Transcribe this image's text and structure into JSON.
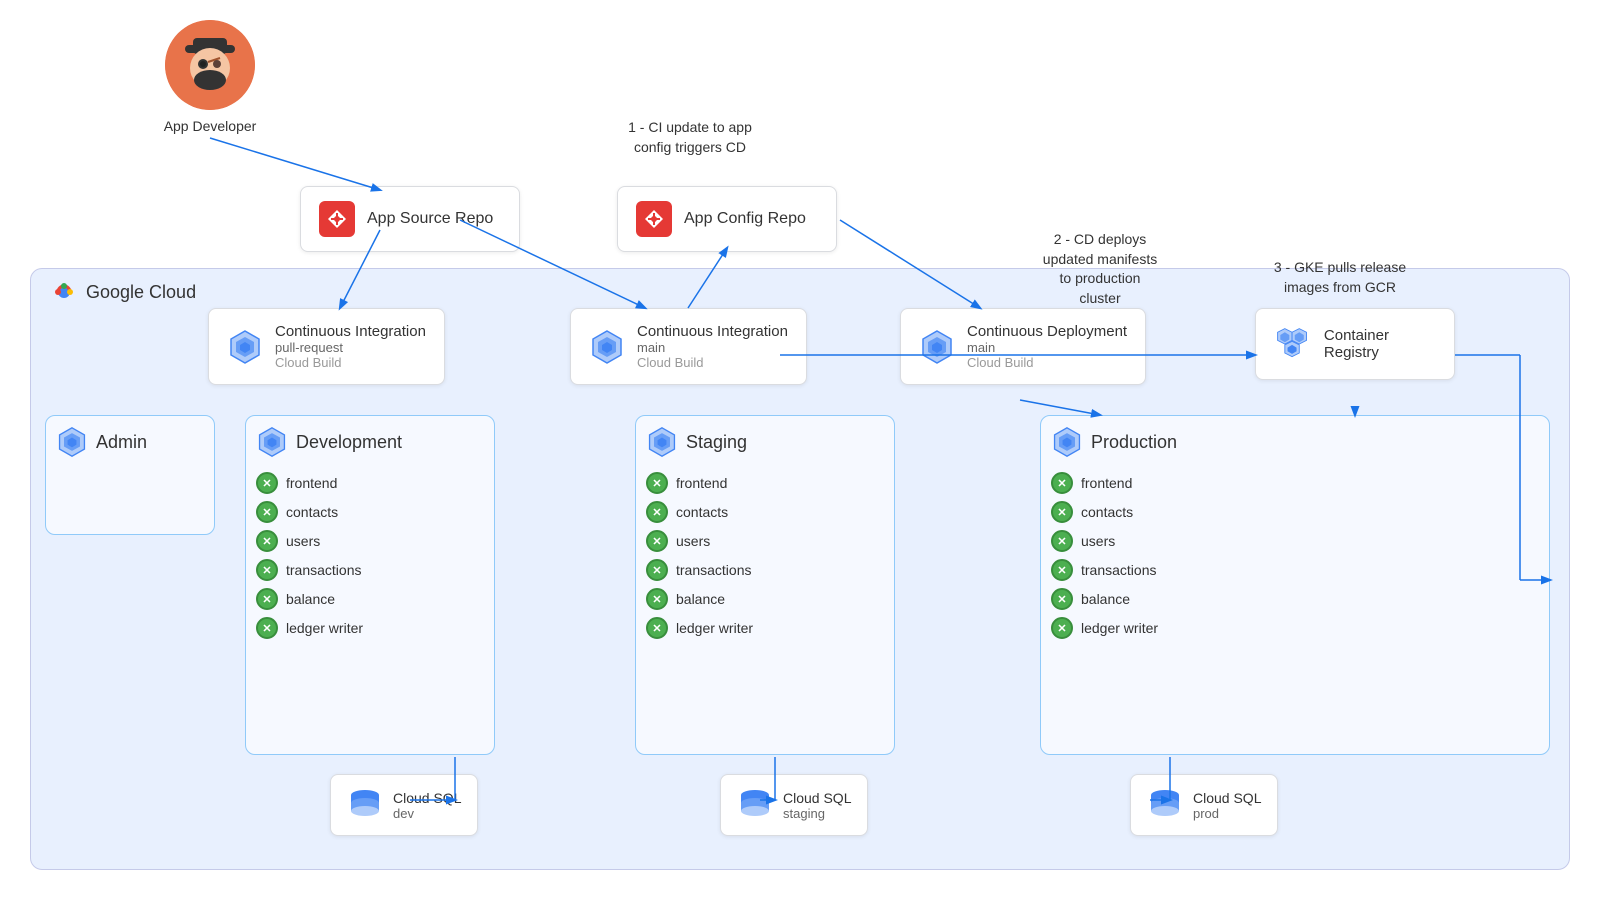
{
  "developer": {
    "label": "App Developer"
  },
  "annotations": {
    "ci_trigger": "1 - CI update to app\nconfig triggers CD",
    "cd_deploy": "2 - CD deploys\nupdated manifests\nto production\ncluster",
    "gke_pull": "3 - GKE pulls release\nimages from GCR"
  },
  "repos": {
    "app_source": "App Source Repo",
    "app_config": "App Config Repo"
  },
  "pipelines": {
    "ci_pr": {
      "title": "Continuous Integration",
      "subtitle": "pull-request",
      "provider": "Cloud Build"
    },
    "ci_main": {
      "title": "Continuous Integration",
      "subtitle": "main",
      "provider": "Cloud Build"
    },
    "cd_main": {
      "title": "Continuous Deployment",
      "subtitle": "main",
      "provider": "Cloud Build"
    }
  },
  "registry": {
    "label": "Container Registry"
  },
  "gcloud": {
    "label": "Google Cloud"
  },
  "clusters": {
    "admin": {
      "title": "Admin",
      "services": []
    },
    "development": {
      "title": "Development",
      "services": [
        "frontend",
        "contacts",
        "users",
        "transactions",
        "balance",
        "ledger writer"
      ]
    },
    "staging": {
      "title": "Staging",
      "services": [
        "frontend",
        "contacts",
        "users",
        "transactions",
        "balance",
        "ledger writer"
      ]
    },
    "production": {
      "title": "Production",
      "services": [
        "frontend",
        "contacts",
        "users",
        "transactions",
        "balance",
        "ledger writer"
      ]
    }
  },
  "databases": {
    "dev": {
      "title": "Cloud SQL",
      "sub": "dev"
    },
    "staging": {
      "title": "Cloud SQL",
      "sub": "staging"
    },
    "prod": {
      "title": "Cloud SQL",
      "sub": "prod"
    }
  }
}
